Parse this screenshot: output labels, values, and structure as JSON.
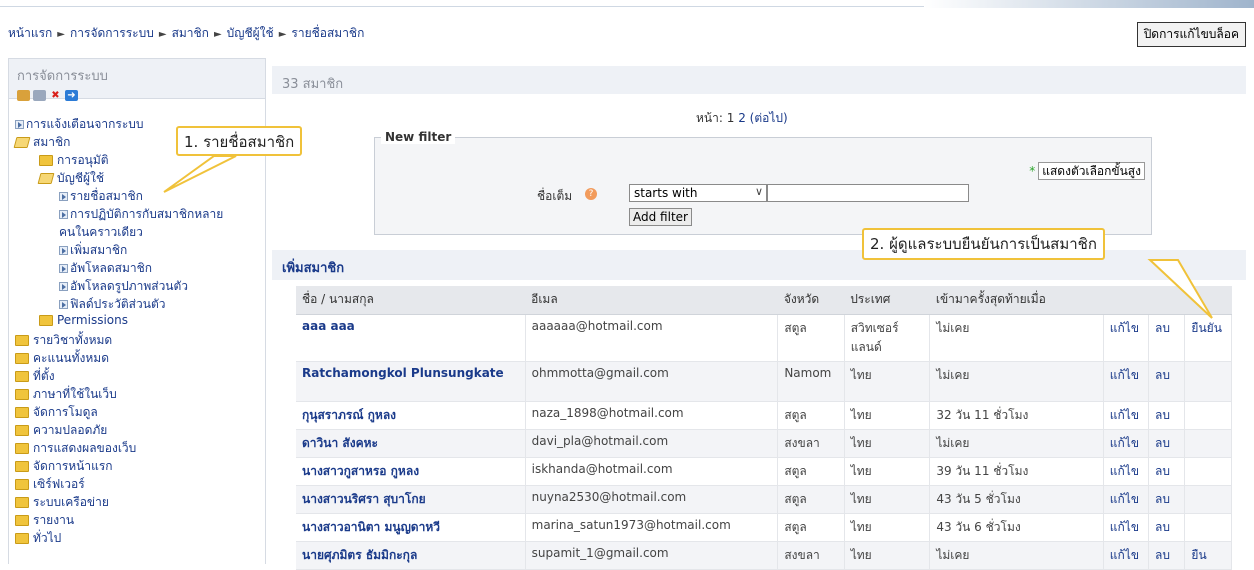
{
  "breadcrumb": [
    "หน้าแรก",
    "การจัดการระบบ",
    "สมาชิก",
    "บัญชีผู้ใช้",
    "รายชื่อสมาชิก"
  ],
  "breadcrumb_sep": "►",
  "edit_button": "ปิดการแก้ไขบล็อค",
  "sidebar": {
    "title": "การจัดการระบบ",
    "items": [
      {
        "label": "การแจ้งเตือนจากระบบ",
        "icon": "bullet-arrow-icon"
      },
      {
        "label": "สมาชิก",
        "icon": "folder-open-icon"
      },
      {
        "label": "การอนุมัติ",
        "icon": "folder-icon"
      },
      {
        "label": "บัญชีผู้ใช้",
        "icon": "folder-open-icon"
      },
      {
        "label": "รายชื่อสมาชิก",
        "icon": "bullet-arrow-icon"
      },
      {
        "label": "การปฏิบัติการกับสมาชิกหลาย",
        "icon": "bullet-arrow-icon"
      },
      {
        "label": "คนในคราวเดียว",
        "icon": ""
      },
      {
        "label": "เพิ่มสมาชิก",
        "icon": "bullet-arrow-icon"
      },
      {
        "label": "อัพโหลดสมาชิก",
        "icon": "bullet-arrow-icon"
      },
      {
        "label": "อัพโหลดรูปภาพส่วนตัว",
        "icon": "bullet-arrow-icon"
      },
      {
        "label": "ฟิลด์ประวัติส่วนตัว",
        "icon": "bullet-arrow-icon"
      },
      {
        "label": "Permissions",
        "icon": "folder-icon"
      },
      {
        "label": "รายวิชาทั้งหมด",
        "icon": "folder-icon"
      },
      {
        "label": "คะแนนทั้งหมด",
        "icon": "folder-icon"
      },
      {
        "label": "ที่ตั้ง",
        "icon": "folder-icon"
      },
      {
        "label": "ภาษาที่ใช้ในเว็บ",
        "icon": "folder-icon"
      },
      {
        "label": "จัดการโมดูล",
        "icon": "folder-icon"
      },
      {
        "label": "ความปลอดภัย",
        "icon": "folder-icon"
      },
      {
        "label": "การแสดงผลของเว็บ",
        "icon": "folder-icon"
      },
      {
        "label": "จัดการหน้าแรก",
        "icon": "folder-icon"
      },
      {
        "label": "เซิร์ฟเวอร์",
        "icon": "folder-icon"
      },
      {
        "label": "ระบบเครือข่าย",
        "icon": "folder-icon"
      },
      {
        "label": "รายงาน",
        "icon": "folder-icon"
      },
      {
        "label": "ทั่วไป",
        "icon": "folder-icon"
      }
    ]
  },
  "main": {
    "member_count": "33 สมาชิก",
    "pager": {
      "label": "หน้า:",
      "page1": "1",
      "page2": "2",
      "next": "(ต่อไป)"
    },
    "filter": {
      "legend": "New filter",
      "advanced": "แสดงตัวเลือกขั้นสูง",
      "field_label": "ชื่อเต็ม",
      "operator": "starts with",
      "value": "",
      "add_button": "Add filter"
    },
    "section_title": "เพิ่มสมาชิก",
    "columns": [
      "ชื่อ / นามสกุล",
      "อีเมล",
      "จังหวัด",
      "ประเทศ",
      "เข้ามาครั้งสุดท้ายเมื่อ",
      "",
      "",
      ""
    ],
    "rows": [
      {
        "name": "aaa aaa",
        "email": "aaaaaa@hotmail.com",
        "province": "สตูล",
        "country": "สวิทเซอร์แลนด์",
        "last": "ไม่เคย",
        "edit": "แก้ไข",
        "del": "ลบ",
        "confirm": "ยืนยัน"
      },
      {
        "name": "Ratchamongkol Plunsungkate",
        "email": "ohmmotta@gmail.com",
        "province": "Namom",
        "country": "ไทย",
        "last": "ไม่เคย",
        "edit": "แก้ไข",
        "del": "ลบ",
        "confirm": ""
      },
      {
        "name": "กุนุสราภรณ์ กูหลง",
        "email": "naza_1898@hotmail.com",
        "province": "สตูล",
        "country": "ไทย",
        "last": "32 วัน 11 ชั่วโมง",
        "edit": "แก้ไข",
        "del": "ลบ",
        "confirm": ""
      },
      {
        "name": "ดาวินา สังคหะ",
        "email": "davi_pla@hotmail.com",
        "province": "สงขลา",
        "country": "ไทย",
        "last": "ไม่เคย",
        "edit": "แก้ไข",
        "del": "ลบ",
        "confirm": ""
      },
      {
        "name": "นางสาวกูสาหรอ กูหลง",
        "email": "iskhanda@hotmail.com",
        "province": "สตูล",
        "country": "ไทย",
        "last": "39 วัน 11 ชั่วโมง",
        "edit": "แก้ไข",
        "del": "ลบ",
        "confirm": ""
      },
      {
        "name": "นางสาวนริศรา สุบาโกย",
        "email": "nuyna2530@hotmail.com",
        "province": "สตูล",
        "country": "ไทย",
        "last": "43 วัน 5 ชั่วโมง",
        "edit": "แก้ไข",
        "del": "ลบ",
        "confirm": ""
      },
      {
        "name": "นางสาวอานิตา มนูญดาหวี",
        "email": "marina_satun1973@hotmail.com",
        "province": "สตูล",
        "country": "ไทย",
        "last": "43 วัน 6 ชั่วโมง",
        "edit": "แก้ไข",
        "del": "ลบ",
        "confirm": ""
      },
      {
        "name": "นายศุภมิตร ธัมมิกะกุล",
        "email": "supamit_1@gmail.com",
        "province": "สงขลา",
        "country": "ไทย",
        "last": "ไม่เคย",
        "edit": "แก้ไข",
        "del": "ลบ",
        "confirm": "ยืน"
      }
    ]
  },
  "annotations": {
    "callout1": "1. รายชื่อสมาชิก",
    "callout2": "2. ผู้ดูแลระบบยืนยันการเป็นสมาชิก"
  },
  "colors": {
    "accent_callout": "#f0c23a",
    "link": "#1a3a8a",
    "panel": "#eef1f6"
  }
}
